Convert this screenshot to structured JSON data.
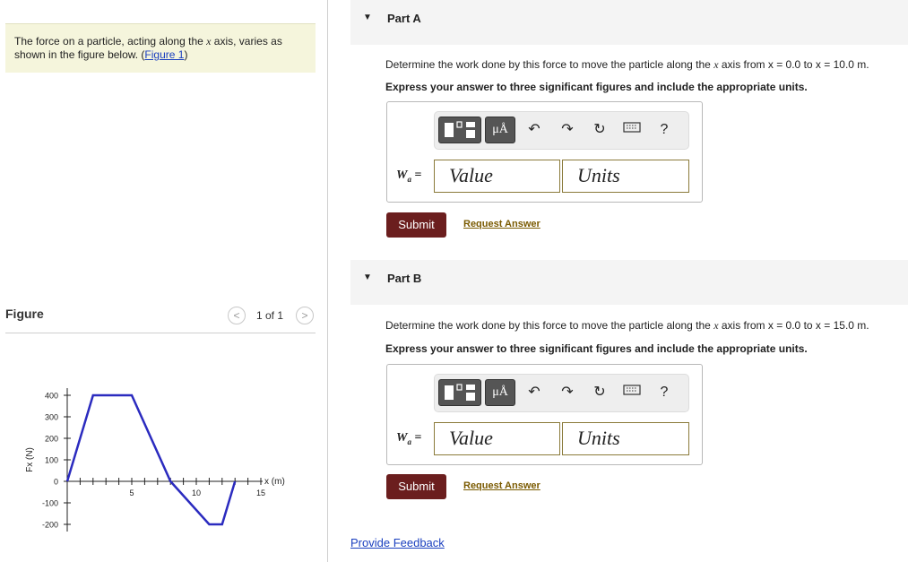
{
  "intro": {
    "text_before": "The force on a particle, acting along the ",
    "var_x": "x",
    "text_after": " axis, varies as shown in the figure below. (",
    "figure_link": "Figure 1",
    "text_close": ")"
  },
  "figure_panel": {
    "title": "Figure",
    "pager": "1 of 1",
    "prev_glyph": "<",
    "next_glyph": ">"
  },
  "parts": [
    {
      "title": "Part A",
      "question_pre": "Determine the work done by this force to move the particle along the ",
      "var_x": "x",
      "question_mid": " axis from ",
      "from_expr": "x = 0.0",
      "to_word": " to ",
      "to_expr": "x = 10.0 m.",
      "instruction": "Express your answer to three significant figures and include the appropriate units.",
      "var_symbol": "W",
      "var_sub": "a",
      "var_equals": " =",
      "value_placeholder": "Value",
      "units_placeholder": "Units",
      "submit": "Submit",
      "request": "Request Answer"
    },
    {
      "title": "Part B",
      "question_pre": "Determine the work done by this force to move the particle along the ",
      "var_x": "x",
      "question_mid": " axis from ",
      "from_expr": "x = 0.0",
      "to_word": " to ",
      "to_expr": "x = 15.0 m.",
      "instruction": "Express your answer to three significant figures and include the appropriate units.",
      "var_symbol": "W",
      "var_sub": "a",
      "var_equals": " =",
      "value_placeholder": "Value",
      "units_placeholder": "Units",
      "submit": "Submit",
      "request": "Request Answer"
    }
  ],
  "toolbar": {
    "mu_label": "μÅ",
    "help": "?",
    "undo_glyph": "↶",
    "redo_glyph": "↷",
    "reset_glyph": "↻",
    "icons": [
      "templates-icon",
      "units-icon",
      "undo-icon",
      "redo-icon",
      "reset-icon",
      "keyboard-icon",
      "help-icon"
    ]
  },
  "feedback": "Provide Feedback",
  "colors": {
    "submit_bg": "#6b1e1e",
    "intro_bg": "#f5f5dc",
    "graph_line": "#2b2bbf",
    "link": "#1a3fbf"
  },
  "chart_data": {
    "type": "line",
    "xlabel": "x (m)",
    "ylabel": "Fx (N)",
    "x_ticks": [
      "5",
      "10",
      "15"
    ],
    "y_ticks": [
      "400",
      "300",
      "200",
      "100",
      "0",
      "-100",
      "-200"
    ],
    "xlim": [
      0,
      15
    ],
    "ylim": [
      -200,
      400
    ],
    "series": [
      {
        "x": [
          0,
          2,
          5,
          8,
          11,
          12,
          13
        ],
        "y": [
          0,
          400,
          400,
          0,
          -200,
          -200,
          0
        ]
      }
    ]
  }
}
